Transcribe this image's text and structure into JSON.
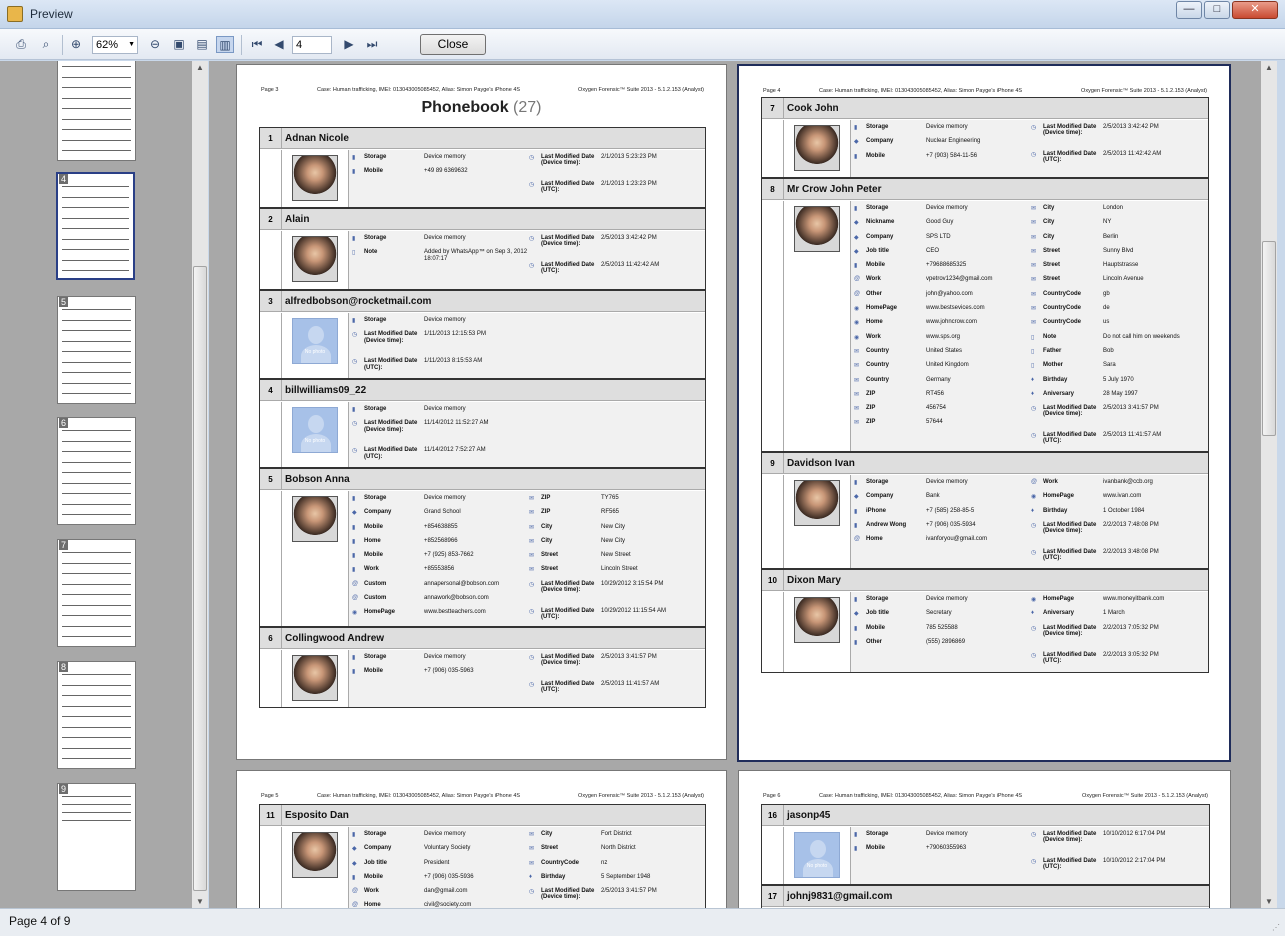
{
  "window": {
    "title": "Preview",
    "minimize": "—",
    "maximize": "□",
    "close": "✕"
  },
  "toolbar": {
    "zoom": "62%",
    "page_number": "4",
    "close_label": "Close",
    "icons": [
      "print-icon",
      "find-icon",
      "zoom-in-icon",
      "zoom-out-icon",
      "single-page-icon",
      "two-page-icon",
      "thumbnails-icon",
      "first-page-icon",
      "previous-page-icon",
      "next-page-icon",
      "last-page-icon"
    ]
  },
  "thumbnails": [
    {
      "label": "",
      "selected": false
    },
    {
      "label": "4",
      "selected": true
    },
    {
      "label": "5",
      "selected": false
    },
    {
      "label": "6",
      "selected": false
    },
    {
      "label": "7",
      "selected": false
    },
    {
      "label": "8",
      "selected": false
    },
    {
      "label": "9",
      "selected": false
    }
  ],
  "report": {
    "case_header": "Case: Human trafficking, IMEI: 013043005085452, Alias: Simon Payge's iPhone 4S",
    "product": "Oxygen Forensic™ Suite 2013 - 5.1.2.153 (Analyst)",
    "section_title": "Phonebook",
    "section_count": "(27)"
  },
  "pages": [
    {
      "label": "Page 3",
      "contacts": [
        {
          "no": "1",
          "name": "Adnan Nicole",
          "photo": true,
          "col1": [
            {
              "ic": "▮",
              "l": "Storage",
              "v": "Device memory"
            },
            {
              "ic": "▮",
              "l": "Mobile",
              "v": "+49 89 6369632"
            }
          ],
          "col2": [
            {
              "ic": "◷",
              "l": "Last Modified Date (Device time):",
              "v": "2/1/2013 5:23:23 PM"
            },
            {
              "ic": "◷",
              "l": "Last Modified Date (UTC):",
              "v": "2/1/2013 1:23:23 PM"
            }
          ]
        },
        {
          "no": "2",
          "name": "Alain",
          "photo": true,
          "col1": [
            {
              "ic": "▮",
              "l": "Storage",
              "v": "Device memory"
            },
            {
              "ic": "▯",
              "l": "Note",
              "v": "Added by WhatsApp™ on Sep 3, 2012 18:07:17"
            }
          ],
          "col2": [
            {
              "ic": "◷",
              "l": "Last Modified Date (Device time):",
              "v": "2/5/2013 3:42:42 PM"
            },
            {
              "ic": "◷",
              "l": "Last Modified Date (UTC):",
              "v": "2/5/2013 11:42:42 AM"
            }
          ]
        },
        {
          "no": "3",
          "name": "alfredbobson@rocketmail.com",
          "photo": false,
          "col1": [
            {
              "ic": "▮",
              "l": "Storage",
              "v": "Device memory"
            },
            {
              "ic": "◷",
              "l": "Last Modified Date (Device time):",
              "v": "1/11/2013 12:15:53 PM"
            },
            {
              "ic": "◷",
              "l": "Last Modified Date (UTC):",
              "v": "1/11/2013 8:15:53 AM"
            }
          ],
          "col2": []
        },
        {
          "no": "4",
          "name": "billwilliams09_22",
          "photo": false,
          "col1": [
            {
              "ic": "▮",
              "l": "Storage",
              "v": "Device memory"
            },
            {
              "ic": "◷",
              "l": "Last Modified Date (Device time):",
              "v": "11/14/2012 11:52:27 AM"
            },
            {
              "ic": "◷",
              "l": "Last Modified Date (UTC):",
              "v": "11/14/2012 7:52:27 AM"
            }
          ],
          "col2": []
        },
        {
          "no": "5",
          "name": "Bobson Anna",
          "photo": true,
          "col1": [
            {
              "ic": "▮",
              "l": "Storage",
              "v": "Device memory"
            },
            {
              "ic": "◆",
              "l": "Company",
              "v": "Grand School"
            },
            {
              "ic": "▮",
              "l": "Mobile",
              "v": "+854638855"
            },
            {
              "ic": "▮",
              "l": "Home",
              "v": "+852568966"
            },
            {
              "ic": "▮",
              "l": "Mobile",
              "v": "+7 (925) 853-7662"
            },
            {
              "ic": "▮",
              "l": "Work",
              "v": "+85553856"
            },
            {
              "ic": "@",
              "l": "Custom",
              "v": "annapersonal@bobson.com"
            },
            {
              "ic": "@",
              "l": "Custom",
              "v": "annawork@bobson.com"
            },
            {
              "ic": "◉",
              "l": "HomePage",
              "v": "www.bestteachers.com"
            }
          ],
          "col2": [
            {
              "ic": "✉",
              "l": "ZIP",
              "v": "TY765"
            },
            {
              "ic": "✉",
              "l": "ZIP",
              "v": "RF565"
            },
            {
              "ic": "✉",
              "l": "City",
              "v": "New City"
            },
            {
              "ic": "✉",
              "l": "City",
              "v": "New City"
            },
            {
              "ic": "✉",
              "l": "Street",
              "v": "New Street"
            },
            {
              "ic": "✉",
              "l": "Street",
              "v": "Lincoln Street"
            },
            {
              "ic": "◷",
              "l": "Last Modified Date (Device time):",
              "v": "10/29/2012 3:15:54 PM"
            },
            {
              "ic": "◷",
              "l": "Last Modified Date (UTC):",
              "v": "10/29/2012 11:15:54 AM"
            }
          ]
        },
        {
          "no": "6",
          "name": "Collingwood Andrew",
          "photo": true,
          "col1": [
            {
              "ic": "▮",
              "l": "Storage",
              "v": "Device memory"
            },
            {
              "ic": "▮",
              "l": "Mobile",
              "v": "+7 (906) 035-5963"
            }
          ],
          "col2": [
            {
              "ic": "◷",
              "l": "Last Modified Date (Device time):",
              "v": "2/5/2013 3:41:57 PM"
            },
            {
              "ic": "◷",
              "l": "Last Modified Date (UTC):",
              "v": "2/5/2013 11:41:57 AM"
            }
          ]
        }
      ]
    },
    {
      "label": "Page 4",
      "contacts": [
        {
          "no": "7",
          "name": "Cook John",
          "photo": true,
          "col1": [
            {
              "ic": "▮",
              "l": "Storage",
              "v": "Device memory"
            },
            {
              "ic": "◆",
              "l": "Company",
              "v": "Nuclear Engineering"
            },
            {
              "ic": "▮",
              "l": "Mobile",
              "v": "+7 (903) 584-11-56"
            }
          ],
          "col2": [
            {
              "ic": "◷",
              "l": "Last Modified Date (Device time):",
              "v": "2/5/2013 3:42:42 PM"
            },
            {
              "ic": "◷",
              "l": "Last Modified Date (UTC):",
              "v": "2/5/2013 11:42:42 AM"
            }
          ]
        },
        {
          "no": "8",
          "name": "Mr Crow John Peter",
          "photo": true,
          "col1": [
            {
              "ic": "▮",
              "l": "Storage",
              "v": "Device memory"
            },
            {
              "ic": "◆",
              "l": "Nickname",
              "v": "Good Guy"
            },
            {
              "ic": "◆",
              "l": "Company",
              "v": "SPS LTD"
            },
            {
              "ic": "◆",
              "l": "Job title",
              "v": "CEO"
            },
            {
              "ic": "▮",
              "l": "Mobile",
              "v": "+79688685325"
            },
            {
              "ic": "@",
              "l": "Work",
              "v": "vpetrov1234@gmail.com"
            },
            {
              "ic": "@",
              "l": "Other",
              "v": "john@yahoo.com"
            },
            {
              "ic": "◉",
              "l": "HomePage",
              "v": "www.bestsevices.com"
            },
            {
              "ic": "◉",
              "l": "Home",
              "v": "www.johncrow.com"
            },
            {
              "ic": "◉",
              "l": "Work",
              "v": "www.sps.org"
            },
            {
              "ic": "✉",
              "l": "Country",
              "v": "United States"
            },
            {
              "ic": "✉",
              "l": "Country",
              "v": "United Kingdom"
            },
            {
              "ic": "✉",
              "l": "Country",
              "v": "Germany"
            },
            {
              "ic": "✉",
              "l": "ZIP",
              "v": "RT456"
            },
            {
              "ic": "✉",
              "l": "ZIP",
              "v": "456754"
            },
            {
              "ic": "✉",
              "l": "ZIP",
              "v": "57644"
            }
          ],
          "col2": [
            {
              "ic": "✉",
              "l": "City",
              "v": "London"
            },
            {
              "ic": "✉",
              "l": "City",
              "v": "NY"
            },
            {
              "ic": "✉",
              "l": "City",
              "v": "Berlin"
            },
            {
              "ic": "✉",
              "l": "Street",
              "v": "Sunny Blvd"
            },
            {
              "ic": "✉",
              "l": "Street",
              "v": "Hauptstrasse"
            },
            {
              "ic": "✉",
              "l": "Street",
              "v": "Lincoln Avenue"
            },
            {
              "ic": "✉",
              "l": "CountryCode",
              "v": "gb"
            },
            {
              "ic": "✉",
              "l": "CountryCode",
              "v": "de"
            },
            {
              "ic": "✉",
              "l": "CountryCode",
              "v": "us"
            },
            {
              "ic": "▯",
              "l": "Note",
              "v": "Do not call him on weekends"
            },
            {
              "ic": "▯",
              "l": "Father",
              "v": "Bob"
            },
            {
              "ic": "▯",
              "l": "Mother",
              "v": "Sara"
            },
            {
              "ic": "♦",
              "l": "Birthday",
              "v": "5 July 1970"
            },
            {
              "ic": "♦",
              "l": "Aniversary",
              "v": "28 May 1997"
            },
            {
              "ic": "◷",
              "l": "Last Modified Date (Device time):",
              "v": "2/5/2013 3:41:57 PM"
            },
            {
              "ic": "◷",
              "l": "Last Modified Date (UTC):",
              "v": "2/5/2013 11:41:57 AM"
            }
          ]
        },
        {
          "no": "9",
          "name": "Davidson Ivan",
          "photo": true,
          "col1": [
            {
              "ic": "▮",
              "l": "Storage",
              "v": "Device memory"
            },
            {
              "ic": "◆",
              "l": "Company",
              "v": "Bank"
            },
            {
              "ic": "▮",
              "l": "iPhone",
              "v": "+7 (585) 258-85-5"
            },
            {
              "ic": "▮",
              "l": "Andrew Wong",
              "v": "+7 (906) 035-5934"
            },
            {
              "ic": "@",
              "l": "Home",
              "v": "ivanforyou@gmail.com"
            }
          ],
          "col2": [
            {
              "ic": "@",
              "l": "Work",
              "v": "ivanbank@ccb.org"
            },
            {
              "ic": "◉",
              "l": "HomePage",
              "v": "www.ivan.com"
            },
            {
              "ic": "♦",
              "l": "Birthday",
              "v": "1 October 1984"
            },
            {
              "ic": "◷",
              "l": "Last Modified Date (Device time):",
              "v": "2/2/2013 7:48:08 PM"
            },
            {
              "ic": "◷",
              "l": "Last Modified Date (UTC):",
              "v": "2/2/2013 3:48:08 PM"
            }
          ]
        },
        {
          "no": "10",
          "name": "Dixon Mary",
          "photo": true,
          "col1": [
            {
              "ic": "▮",
              "l": "Storage",
              "v": "Device memory"
            },
            {
              "ic": "◆",
              "l": "Job title",
              "v": "Secretary"
            },
            {
              "ic": "▮",
              "l": "Mobile",
              "v": "785 525588"
            },
            {
              "ic": "▮",
              "l": "Other",
              "v": "(555) 2896869"
            }
          ],
          "col2": [
            {
              "ic": "◉",
              "l": "HomePage",
              "v": "www.moneyitbank.com"
            },
            {
              "ic": "♦",
              "l": "Aniversary",
              "v": "1 March"
            },
            {
              "ic": "◷",
              "l": "Last Modified Date (Device time):",
              "v": "2/2/2013 7:05:32 PM"
            },
            {
              "ic": "◷",
              "l": "Last Modified Date (UTC):",
              "v": "2/2/2013 3:05:32 PM"
            }
          ]
        }
      ]
    },
    {
      "label": "Page 5",
      "contacts": [
        {
          "no": "11",
          "name": "Esposito Dan",
          "photo": true,
          "col1": [
            {
              "ic": "▮",
              "l": "Storage",
              "v": "Device memory"
            },
            {
              "ic": "◆",
              "l": "Company",
              "v": "Voluntary Society"
            },
            {
              "ic": "◆",
              "l": "Job title",
              "v": "President"
            },
            {
              "ic": "▮",
              "l": "Mobile",
              "v": "+7 (906) 035-5936"
            },
            {
              "ic": "@",
              "l": "Work",
              "v": "dan@gmail.com"
            },
            {
              "ic": "@",
              "l": "Home",
              "v": "civil@society.com"
            }
          ],
          "col2": [
            {
              "ic": "✉",
              "l": "City",
              "v": "Fort District"
            },
            {
              "ic": "✉",
              "l": "Street",
              "v": "North District"
            },
            {
              "ic": "✉",
              "l": "CountryCode",
              "v": "nz"
            },
            {
              "ic": "♦",
              "l": "Birthday",
              "v": "5 September 1948"
            },
            {
              "ic": "◷",
              "l": "Last Modified Date (Device time):",
              "v": "2/5/2013 3:41:57 PM"
            }
          ]
        }
      ]
    },
    {
      "label": "Page 6",
      "contacts": [
        {
          "no": "16",
          "name": "jasonp45",
          "photo": false,
          "col1": [
            {
              "ic": "▮",
              "l": "Storage",
              "v": "Device memory"
            },
            {
              "ic": "▮",
              "l": "Mobile",
              "v": "+79060355963"
            }
          ],
          "col2": [
            {
              "ic": "◷",
              "l": "Last Modified Date (Device time):",
              "v": "10/10/2012 6:17:04 PM"
            },
            {
              "ic": "◷",
              "l": "Last Modified Date (UTC):",
              "v": "10/10/2012 2:17:04 PM"
            }
          ]
        },
        {
          "no": "17",
          "name": "johnj9831@gmail.com",
          "photo": false,
          "col1": [],
          "col2": []
        }
      ]
    }
  ],
  "no_photo_label": "No photo",
  "status": {
    "text": "Page 4 of 9"
  }
}
